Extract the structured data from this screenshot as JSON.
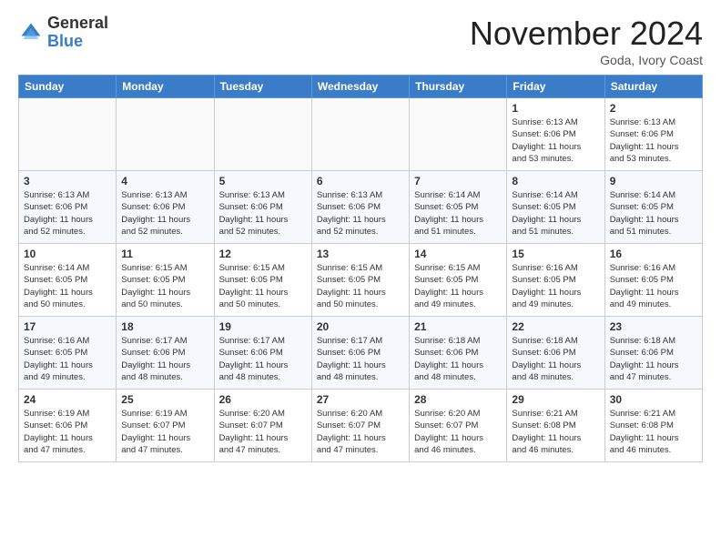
{
  "header": {
    "logo_general": "General",
    "logo_blue": "Blue",
    "month_title": "November 2024",
    "location": "Goda, Ivory Coast"
  },
  "weekdays": [
    "Sunday",
    "Monday",
    "Tuesday",
    "Wednesday",
    "Thursday",
    "Friday",
    "Saturday"
  ],
  "weeks": [
    [
      {
        "day": "",
        "info": ""
      },
      {
        "day": "",
        "info": ""
      },
      {
        "day": "",
        "info": ""
      },
      {
        "day": "",
        "info": ""
      },
      {
        "day": "",
        "info": ""
      },
      {
        "day": "1",
        "info": "Sunrise: 6:13 AM\nSunset: 6:06 PM\nDaylight: 11 hours\nand 53 minutes."
      },
      {
        "day": "2",
        "info": "Sunrise: 6:13 AM\nSunset: 6:06 PM\nDaylight: 11 hours\nand 53 minutes."
      }
    ],
    [
      {
        "day": "3",
        "info": "Sunrise: 6:13 AM\nSunset: 6:06 PM\nDaylight: 11 hours\nand 52 minutes."
      },
      {
        "day": "4",
        "info": "Sunrise: 6:13 AM\nSunset: 6:06 PM\nDaylight: 11 hours\nand 52 minutes."
      },
      {
        "day": "5",
        "info": "Sunrise: 6:13 AM\nSunset: 6:06 PM\nDaylight: 11 hours\nand 52 minutes."
      },
      {
        "day": "6",
        "info": "Sunrise: 6:13 AM\nSunset: 6:06 PM\nDaylight: 11 hours\nand 52 minutes."
      },
      {
        "day": "7",
        "info": "Sunrise: 6:14 AM\nSunset: 6:05 PM\nDaylight: 11 hours\nand 51 minutes."
      },
      {
        "day": "8",
        "info": "Sunrise: 6:14 AM\nSunset: 6:05 PM\nDaylight: 11 hours\nand 51 minutes."
      },
      {
        "day": "9",
        "info": "Sunrise: 6:14 AM\nSunset: 6:05 PM\nDaylight: 11 hours\nand 51 minutes."
      }
    ],
    [
      {
        "day": "10",
        "info": "Sunrise: 6:14 AM\nSunset: 6:05 PM\nDaylight: 11 hours\nand 50 minutes."
      },
      {
        "day": "11",
        "info": "Sunrise: 6:15 AM\nSunset: 6:05 PM\nDaylight: 11 hours\nand 50 minutes."
      },
      {
        "day": "12",
        "info": "Sunrise: 6:15 AM\nSunset: 6:05 PM\nDaylight: 11 hours\nand 50 minutes."
      },
      {
        "day": "13",
        "info": "Sunrise: 6:15 AM\nSunset: 6:05 PM\nDaylight: 11 hours\nand 50 minutes."
      },
      {
        "day": "14",
        "info": "Sunrise: 6:15 AM\nSunset: 6:05 PM\nDaylight: 11 hours\nand 49 minutes."
      },
      {
        "day": "15",
        "info": "Sunrise: 6:16 AM\nSunset: 6:05 PM\nDaylight: 11 hours\nand 49 minutes."
      },
      {
        "day": "16",
        "info": "Sunrise: 6:16 AM\nSunset: 6:05 PM\nDaylight: 11 hours\nand 49 minutes."
      }
    ],
    [
      {
        "day": "17",
        "info": "Sunrise: 6:16 AM\nSunset: 6:05 PM\nDaylight: 11 hours\nand 49 minutes."
      },
      {
        "day": "18",
        "info": "Sunrise: 6:17 AM\nSunset: 6:06 PM\nDaylight: 11 hours\nand 48 minutes."
      },
      {
        "day": "19",
        "info": "Sunrise: 6:17 AM\nSunset: 6:06 PM\nDaylight: 11 hours\nand 48 minutes."
      },
      {
        "day": "20",
        "info": "Sunrise: 6:17 AM\nSunset: 6:06 PM\nDaylight: 11 hours\nand 48 minutes."
      },
      {
        "day": "21",
        "info": "Sunrise: 6:18 AM\nSunset: 6:06 PM\nDaylight: 11 hours\nand 48 minutes."
      },
      {
        "day": "22",
        "info": "Sunrise: 6:18 AM\nSunset: 6:06 PM\nDaylight: 11 hours\nand 48 minutes."
      },
      {
        "day": "23",
        "info": "Sunrise: 6:18 AM\nSunset: 6:06 PM\nDaylight: 11 hours\nand 47 minutes."
      }
    ],
    [
      {
        "day": "24",
        "info": "Sunrise: 6:19 AM\nSunset: 6:06 PM\nDaylight: 11 hours\nand 47 minutes."
      },
      {
        "day": "25",
        "info": "Sunrise: 6:19 AM\nSunset: 6:07 PM\nDaylight: 11 hours\nand 47 minutes."
      },
      {
        "day": "26",
        "info": "Sunrise: 6:20 AM\nSunset: 6:07 PM\nDaylight: 11 hours\nand 47 minutes."
      },
      {
        "day": "27",
        "info": "Sunrise: 6:20 AM\nSunset: 6:07 PM\nDaylight: 11 hours\nand 47 minutes."
      },
      {
        "day": "28",
        "info": "Sunrise: 6:20 AM\nSunset: 6:07 PM\nDaylight: 11 hours\nand 46 minutes."
      },
      {
        "day": "29",
        "info": "Sunrise: 6:21 AM\nSunset: 6:08 PM\nDaylight: 11 hours\nand 46 minutes."
      },
      {
        "day": "30",
        "info": "Sunrise: 6:21 AM\nSunset: 6:08 PM\nDaylight: 11 hours\nand 46 minutes."
      }
    ]
  ]
}
